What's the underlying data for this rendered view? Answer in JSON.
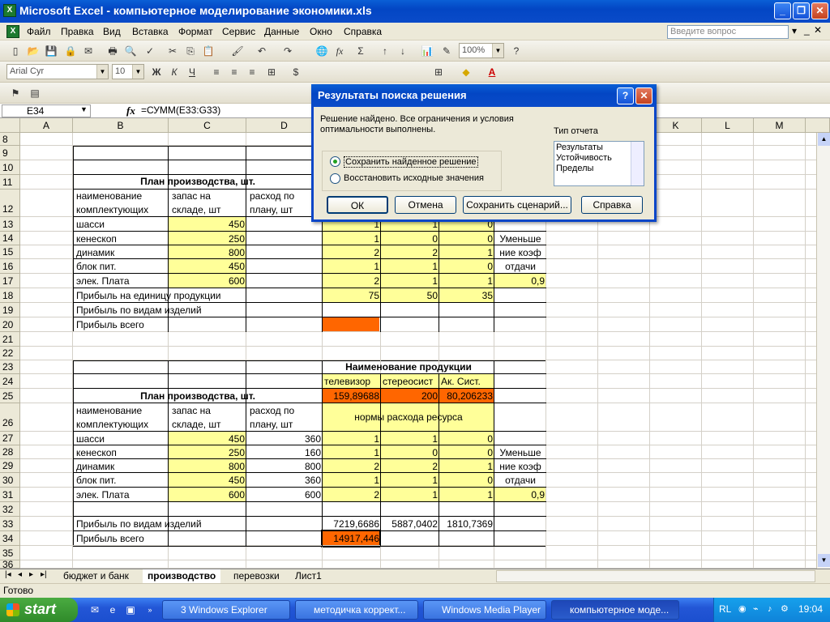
{
  "window": {
    "title": "Microsoft Excel - компьютерное моделирование экономики.xls",
    "app_icon": "X"
  },
  "menu": [
    "Файл",
    "Правка",
    "Вид",
    "Вставка",
    "Формат",
    "Сервис",
    "Данные",
    "Окно",
    "Справка"
  ],
  "question_box": {
    "placeholder": "Введите вопрос"
  },
  "toolbar": {
    "zoom": "100%",
    "font_name": "Arial Cyr",
    "font_size": "10",
    "bold": "Ж",
    "italic": "К",
    "underline": "Ч",
    "font_color_letter": "А"
  },
  "formula_bar": {
    "cell_ref": "E34",
    "fx": "fx",
    "formula": "=СУММ(E33:G33)"
  },
  "columns": [
    "A",
    "B",
    "C",
    "D",
    "",
    "",
    "",
    "",
    "K",
    "L",
    "M"
  ],
  "rows": [
    "8",
    "9",
    "10",
    "11",
    "12",
    "13",
    "14",
    "15",
    "16",
    "17",
    "18",
    "19",
    "20",
    "21",
    "22",
    "23",
    "24",
    "25",
    "26",
    "27",
    "28",
    "29",
    "30",
    "31",
    "32",
    "33",
    "34",
    "35",
    "36"
  ],
  "cells": {
    "t1_title": "План производства, шт.",
    "h_name": "наименование комплектующих",
    "h_stock": "запас на складе, шт",
    "h_plan": "расход по плану, шт",
    "r13_b": "шасси",
    "r13_c": "450",
    "r13_e": "1",
    "r13_f": "1",
    "r13_g": "0",
    "r14_b": "кенескоп",
    "r14_c": "250",
    "r14_e": "1",
    "r14_f": "0",
    "r14_g": "0",
    "r14_h": "Уменьше",
    "r15_b": "динамик",
    "r15_c": "800",
    "r15_e": "2",
    "r15_f": "2",
    "r15_g": "1",
    "r15_h": "ние коэф",
    "r16_b": "блок пит.",
    "r16_c": "450",
    "r16_e": "1",
    "r16_f": "1",
    "r16_g": "0",
    "r16_h": "отдачи",
    "r17_b": "элек. Плата",
    "r17_c": "600",
    "r17_e": "2",
    "r17_f": "1",
    "r17_g": "1",
    "r17_h": "0,9",
    "r18_b": "Прибыль на единицу продукции",
    "r18_e": "75",
    "r18_f": "50",
    "r18_g": "35",
    "r19_b": "Прибыль по видам изделий",
    "r20_b": "Прибыль всего",
    "r23_e": "Наименование продукции",
    "r24_e": "телевизор",
    "r24_f": "стереосист",
    "r24_g": "Ак. Сист.",
    "r25_b": "План производства, шт.",
    "r25_e": "159,89688",
    "r25_f": "200",
    "r25_g": "80,206233",
    "r26_e": "нормы расхода ресурса",
    "r27_b": "шасси",
    "r27_c": "450",
    "r27_d": "360",
    "r27_e": "1",
    "r27_f": "1",
    "r27_g": "0",
    "r28_b": "кенескоп",
    "r28_c": "250",
    "r28_d": "160",
    "r28_e": "1",
    "r28_f": "0",
    "r28_g": "0",
    "r28_h": "Уменьше",
    "r29_b": "динамик",
    "r29_c": "800",
    "r29_d": "800",
    "r29_e": "2",
    "r29_f": "2",
    "r29_g": "1",
    "r29_h": "ние коэф",
    "r30_b": "блок пит.",
    "r30_c": "450",
    "r30_d": "360",
    "r30_e": "1",
    "r30_f": "1",
    "r30_g": "0",
    "r30_h": "отдачи",
    "r31_b": "элек. Плата",
    "r31_c": "600",
    "r31_d": "600",
    "r31_e": "2",
    "r31_f": "1",
    "r31_g": "1",
    "r31_h": "0,9",
    "r33_b": "Прибыль по видам изделий",
    "r33_e": "7219,6686",
    "r33_f": "5887,0402",
    "r33_g": "1810,7369",
    "r34_b": "Прибыль всего",
    "r34_e": "14917,446"
  },
  "sheet_tabs": [
    "бюджет и банк",
    "производство",
    "перевозки",
    "Лист1"
  ],
  "status": "Готово",
  "dialog": {
    "title": "Результаты поиска решения",
    "message": "Решение найдено. Все ограничения и условия оптимальности выполнены.",
    "report_label": "Тип отчета",
    "reports": [
      "Результаты",
      "Устойчивость",
      "Пределы"
    ],
    "opt_keep": "Сохранить найденное решение",
    "opt_restore": "Восстановить исходные значения",
    "btn_ok": "ОК",
    "btn_cancel": "Отмена",
    "btn_save": "Сохранить сценарий...",
    "btn_help": "Справка"
  },
  "taskbar": {
    "start": "start",
    "tasks": [
      "3 Windows Explorer",
      "методичка коррект...",
      "Windows Media Player",
      "компьютерное моде..."
    ],
    "lang": "RL",
    "clock": "19:04"
  }
}
